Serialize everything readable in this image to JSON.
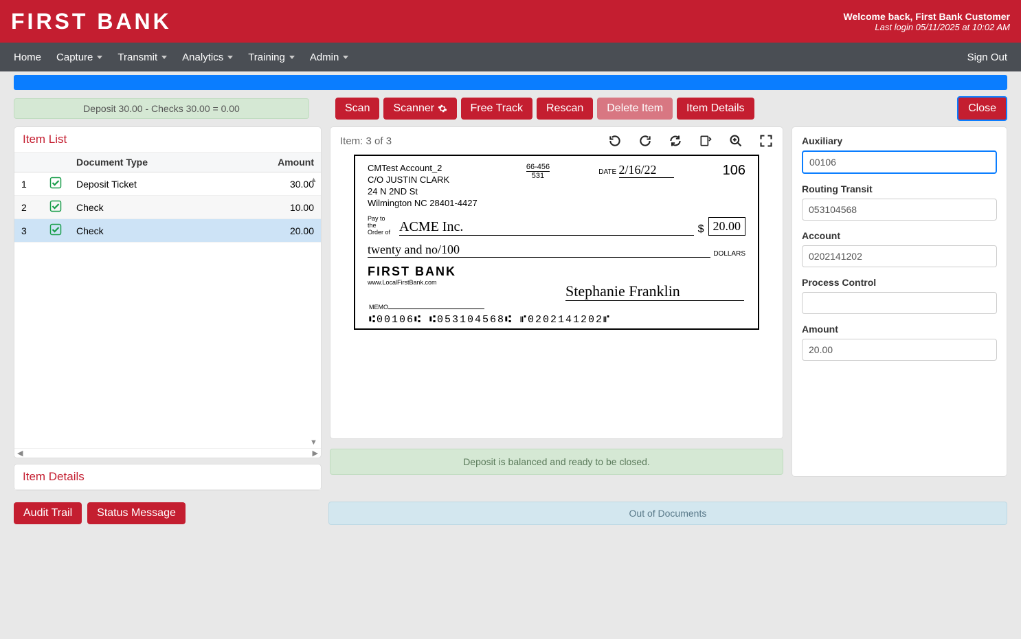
{
  "header": {
    "logo": "FIRST BANK",
    "welcome": "Welcome back, First Bank Customer",
    "last_login": "Last login 05/11/2025 at 10:02 AM"
  },
  "nav": {
    "items": [
      "Home",
      "Capture",
      "Transmit",
      "Analytics",
      "Training",
      "Admin"
    ],
    "sign_out": "Sign Out"
  },
  "balance_badge": "Deposit 30.00 - Checks 30.00 = 0.00",
  "toolbar": {
    "scan": "Scan",
    "scanner": "Scanner",
    "free_track": "Free Track",
    "rescan": "Rescan",
    "delete_item": "Delete Item",
    "item_details": "Item Details",
    "close": "Close"
  },
  "item_list": {
    "title": "Item List",
    "columns": {
      "doc_type": "Document Type",
      "amount": "Amount"
    },
    "rows": [
      {
        "num": "1",
        "doc_type": "Deposit Ticket",
        "amount": "30.00",
        "selected": false
      },
      {
        "num": "2",
        "doc_type": "Check",
        "amount": "10.00",
        "selected": false
      },
      {
        "num": "3",
        "doc_type": "Check",
        "amount": "20.00",
        "selected": true
      }
    ]
  },
  "item_details_title": "Item Details",
  "viewer": {
    "label": "Item:  3 of  3"
  },
  "check": {
    "account_name": "CMTest Account_2",
    "care_of": "C/O JUSTIN CLARK",
    "street": "24 N 2ND St",
    "city_state": "Wilmington NC 28401-4427",
    "routing_small_top": "66-456",
    "routing_small_bot": "531",
    "date_label": "DATE",
    "date": "2/16/22",
    "number": "106",
    "pay_to_label": "Pay to the\nOrder of",
    "payee": "ACME Inc.",
    "amount_numeric": "20.00",
    "amount_words": "twenty and no/100",
    "dollars_label": "DOLLARS",
    "bank_logo": "FIRST BANK",
    "url": "www.LocalFirstBank.com",
    "memo_label": "MEMO",
    "signature": "Stephanie Franklin",
    "micr": "⑆00106⑆  ⑆053104568⑆  ⑈0202141202⑈"
  },
  "balanced_msg": "Deposit is balanced and ready to be closed.",
  "form": {
    "auxiliary": {
      "label": "Auxiliary",
      "value": "00106"
    },
    "routing": {
      "label": "Routing Transit",
      "value": "053104568"
    },
    "account": {
      "label": "Account",
      "value": "0202141202"
    },
    "process_control": {
      "label": "Process Control",
      "value": ""
    },
    "amount": {
      "label": "Amount",
      "value": "20.00"
    }
  },
  "bottom": {
    "audit_trail": "Audit Trail",
    "status_message": "Status Message",
    "out_of_documents": "Out of Documents"
  }
}
